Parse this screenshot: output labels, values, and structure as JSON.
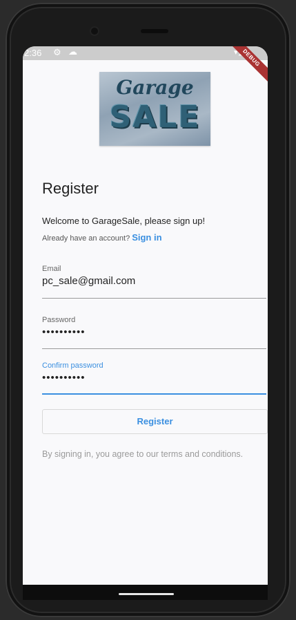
{
  "status_bar": {
    "time": "2:36",
    "icons": [
      "gear-icon",
      "cloud-icon",
      "wifi-icon",
      "signal-icon",
      "battery-icon"
    ]
  },
  "debug_banner": "DEBUG",
  "logo": {
    "line1": "Garage",
    "line2": "SALE"
  },
  "page": {
    "title": "Register",
    "welcome": "Welcome to GarageSale, please sign up!",
    "already_account": "Already have an account?",
    "sign_in_link": "Sign in"
  },
  "form": {
    "email": {
      "label": "Email",
      "value": "pc_sale@gmail.com"
    },
    "password": {
      "label": "Password",
      "value": "••••••••••"
    },
    "confirm_password": {
      "label": "Confirm password",
      "value": "••••••••••"
    },
    "register_button": "Register",
    "terms": "By signing in, you agree to our terms and conditions."
  },
  "colors": {
    "accent": "#3a8fe0",
    "background": "#f9f9fb",
    "statusbar": "#cccccc"
  }
}
